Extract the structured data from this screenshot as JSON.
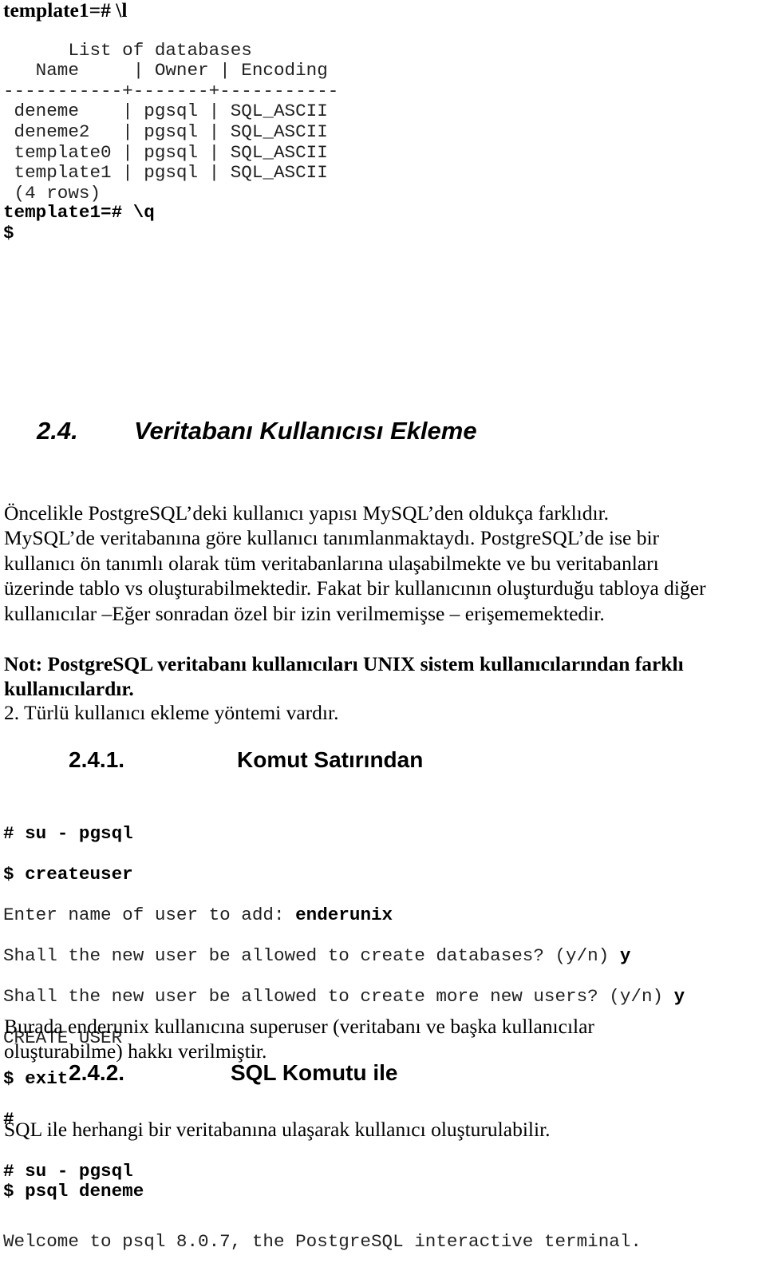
{
  "top_prompt": "template1=# \\l",
  "db_list": [
    "      List of databases",
    "   Name     | Owner | Encoding",
    "-----------+-------+-----------",
    " deneme    | pgsql | SQL_ASCII",
    " deneme2   | pgsql | SQL_ASCII",
    " template0 | pgsql | SQL_ASCII",
    " template1 | pgsql | SQL_ASCII",
    " (4 rows)"
  ],
  "quit_cmd": "template1=# \\q",
  "dollar": "$",
  "section": {
    "number": "2.4.",
    "title": "Veritabanı Kullanıcısı Ekleme"
  },
  "para1": [
    "Öncelikle PostgreSQL’deki kullanıcı yapısı MySQL’den oldukça farklıdır.",
    "MySQL’de veritabanına göre kullanıcı tanımlanmaktaydı. PostgreSQL’de ise bir",
    "kullanıcı ön tanımlı olarak tüm veritabanlarına ulaşabilmekte ve bu veritabanları",
    "üzerinde tablo vs oluşturabilmektedir. Fakat bir kullanıcının oluşturduğu tabloya diğer",
    "kullanıcılar –Eğer sonradan özel bir izin verilmemişse – erişememektedir."
  ],
  "note": [
    "Not: PostgreSQL veritabanı kullanıcıları UNIX sistem kullanıcılarından farklı",
    "kullanıcılardır."
  ],
  "methods": "2. Türlü kullanıcı ekleme yöntemi vardır.",
  "sub1": {
    "number": "2.4.1.",
    "title": "Komut Satırından"
  },
  "cli": {
    "l1": "# su - pgsql",
    "l2": "$ createuser",
    "l3a": "Enter name of user to add: ",
    "l3b": "enderunix",
    "l4a": "Shall the new user be allowed to create databases? (y/n) ",
    "l4b": "y",
    "l5a": "Shall the new user be allowed to create more new users? (y/n) ",
    "l5b": "y",
    "l6": "CREATE USER",
    "l7": "$ exit",
    "l8": "#"
  },
  "para2": [
    "Burada enderunix kullanıcına superuser (veritabanı ve başka kullanıcılar",
    "oluşturabilme) hakkı verilmiştir."
  ],
  "sub2": {
    "number": "2.4.2.",
    "title": "SQL Komutu ile"
  },
  "para3": "SQL ile herhangi bir veritabanına ulaşarak kullanıcı oluşturulabilir.",
  "sql_cmds": [
    "# su - pgsql",
    "$ psql deneme"
  ],
  "welcome": "Welcome to psql 8.0.7, the PostgreSQL interactive terminal."
}
